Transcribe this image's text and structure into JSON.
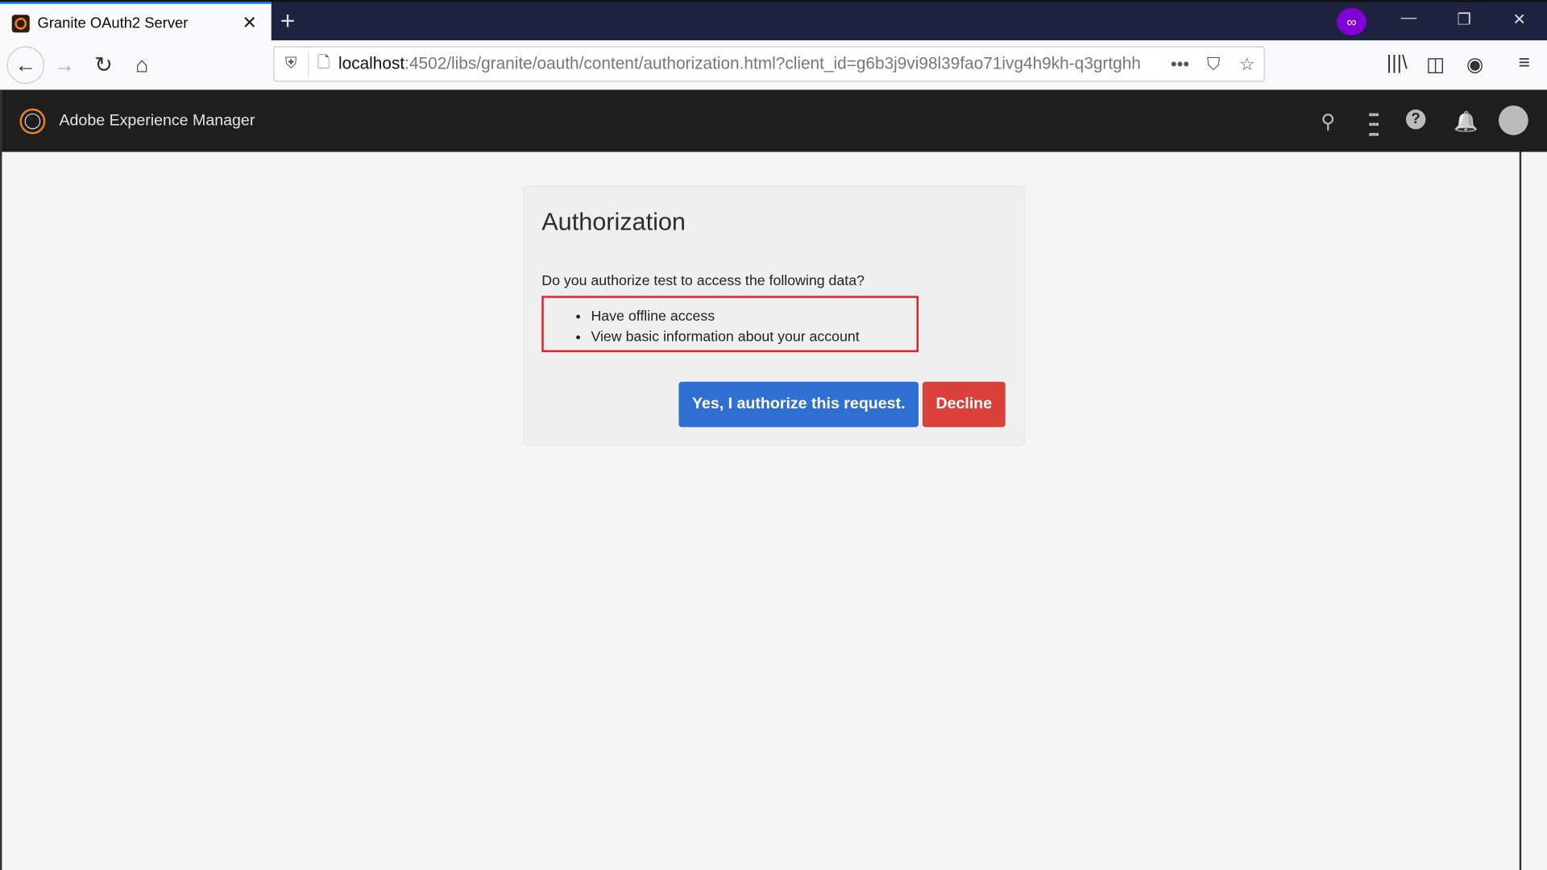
{
  "browser": {
    "tab_title": "Granite OAuth2 Server",
    "tab_close": "✕",
    "new_tab": "+",
    "private_icon": "private-browsing-mask-icon",
    "window": {
      "minimize": "—",
      "restore": "❐",
      "close": "✕"
    },
    "nav": {
      "back": "←",
      "forward": "→",
      "reload": "↻",
      "home": "⌂"
    },
    "url_host": "localhost",
    "url_rest": ":4502/libs/granite/oauth/content/authorization.html?client_id=g6b3j9vi98l39fao71ivg4h9kh-q3grtghh",
    "url_more": "•••",
    "pocket": "⛉",
    "bookmark": "☆",
    "library": "|||\\",
    "sidebar": "◫",
    "account": "◉",
    "menu": "≡"
  },
  "aem": {
    "brand": "Adobe Experience Manager",
    "search": "⚲",
    "apps": "⋮⋮⋮",
    "help": "?",
    "notifications": "🔔"
  },
  "card": {
    "title": "Authorization",
    "question": "Do you authorize test to access the following data?",
    "scopes": [
      "Have offline access",
      "View basic information about your account"
    ],
    "authorize_label": "Yes, I authorize this request.",
    "decline_label": "Decline",
    "colors": {
      "authorize": "#2e6fd1",
      "decline": "#d9413a",
      "highlight": "#e51d2a"
    }
  }
}
